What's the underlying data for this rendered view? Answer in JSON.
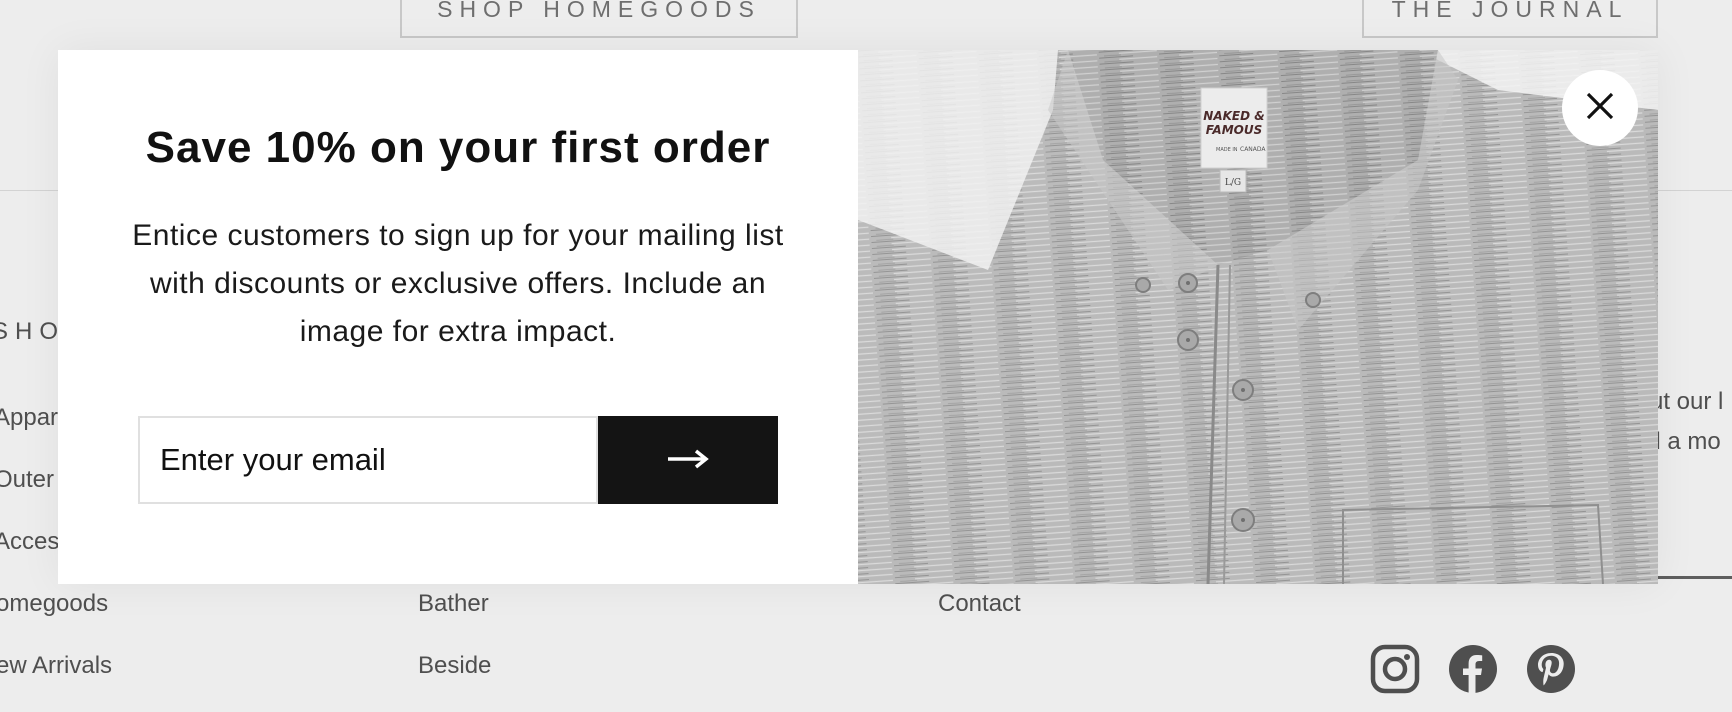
{
  "header": {
    "shop_button_label": "SHOP HOMEGOODS",
    "journal_button_label": "THE JOURNAL"
  },
  "footer": {
    "column_heading": "SHO",
    "shop_links": [
      "Appar",
      "Outer",
      "Acces",
      "omegoods",
      "ew Arrivals"
    ],
    "middle_links": [
      "Bather",
      "Beside"
    ],
    "contact_link": "Contact",
    "right_text_lines": [
      "ut our l",
      "il a mo"
    ]
  },
  "social": {
    "icons": [
      "instagram-icon",
      "facebook-icon",
      "pinterest-icon"
    ]
  },
  "popup": {
    "title": "Save 10% on your first order",
    "description": "Entice customers to sign up for your mailing list with discounts or exclusive offers. Include an image for extra impact.",
    "email_placeholder": "Enter your email",
    "submit_icon": "arrow-right-icon",
    "close_icon": "close-icon",
    "image": {
      "label_line1": "NAKED &",
      "label_line2": "FAMOUS",
      "label_small_left": "MADE IN",
      "label_small_right": "CANADA",
      "size_tag": "L/G"
    }
  },
  "colors": {
    "text_dark": "#111111",
    "button_bg": "#141414",
    "muted_text": "#555555",
    "overlay": "rgba(0,0,0,0.07)"
  }
}
